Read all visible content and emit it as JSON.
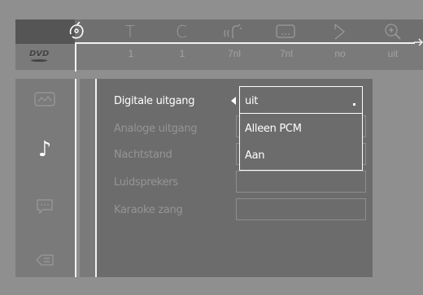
{
  "top_tabs": [
    {
      "icon": "disc-icon",
      "value": ""
    },
    {
      "icon": "title-icon",
      "value": "1"
    },
    {
      "icon": "chapter-icon",
      "value": "1"
    },
    {
      "icon": "audio-language-icon",
      "value": "7nl"
    },
    {
      "icon": "subtitle-icon",
      "value": "7nl"
    },
    {
      "icon": "angle-icon",
      "value": "no"
    },
    {
      "icon": "zoom-icon",
      "value": "uit"
    }
  ],
  "top_glyphs": {
    "title": "T",
    "chapter": "C"
  },
  "sidebar": {
    "items": [
      {
        "icon": "picture-icon"
      },
      {
        "icon": "music-note-icon",
        "glyph": "♪"
      },
      {
        "icon": "speech-bubble-icon"
      },
      {
        "icon": "exit-icon"
      }
    ]
  },
  "settings": {
    "rows": [
      {
        "label": "Digitale uitgang"
      },
      {
        "label": "Analoge uitgang"
      },
      {
        "label": "Nachtstand"
      },
      {
        "label": "Luidsprekers"
      },
      {
        "label": "Karaoke zang"
      }
    ],
    "dropdown": {
      "selected": "uit",
      "options": [
        "Alleen PCM",
        "Aan"
      ]
    }
  },
  "colors": {
    "background": "#8f8f8f",
    "panel": "#6c6c6c",
    "highlight": "#ffffff",
    "dim_text": "#959595"
  }
}
